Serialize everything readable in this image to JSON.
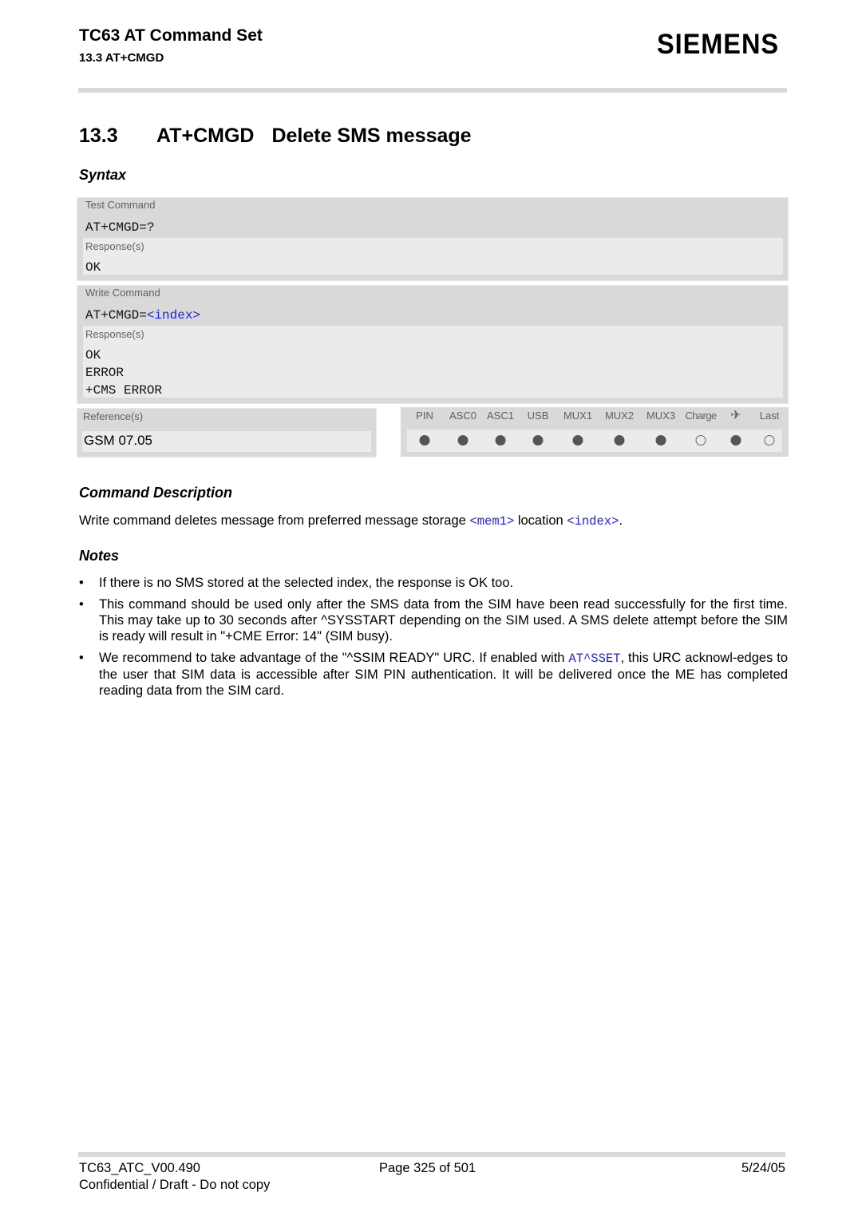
{
  "header": {
    "title": "TC63 AT Command Set",
    "subtitle": "13.3 AT+CMGD",
    "logo": "SIEMENS"
  },
  "section": {
    "number": "13.3",
    "command": "AT+CMGD",
    "title": "Delete SMS message"
  },
  "syntax": {
    "heading": "Syntax",
    "test_command": {
      "label": "Test Command",
      "command": "AT+CMGD=?",
      "responses_label": "Response(s)",
      "responses": [
        "OK"
      ]
    },
    "write_command": {
      "label": "Write Command",
      "command_prefix": "AT+CMGD=",
      "command_param": "<index>",
      "responses_label": "Response(s)",
      "responses": [
        "OK",
        "ERROR",
        "+CMS ERROR"
      ]
    },
    "references": {
      "label": "Reference(s)",
      "value": "GSM 07.05"
    },
    "channels": [
      {
        "label": "PIN",
        "supported": true
      },
      {
        "label": "ASC0",
        "supported": true
      },
      {
        "label": "ASC1",
        "supported": true
      },
      {
        "label": "USB",
        "supported": true
      },
      {
        "label": "MUX1",
        "supported": true
      },
      {
        "label": "MUX2",
        "supported": true
      },
      {
        "label": "MUX3",
        "supported": true
      },
      {
        "label": "Charge",
        "supported": false
      },
      {
        "label": "✈",
        "icon": "airplane-icon",
        "supported": true
      },
      {
        "label": "Last",
        "supported": false
      }
    ]
  },
  "description": {
    "heading": "Command Description",
    "text_before": "Write command deletes message from preferred message storage ",
    "param1": "<mem1>",
    "text_middle": " location ",
    "param2": "<index>",
    "text_after": "."
  },
  "notes": {
    "heading": "Notes",
    "items": [
      {
        "text": "If there is no SMS stored at the selected index, the response is OK too."
      },
      {
        "text": "This command should be used only after the SMS data from the SIM have been read successfully for the first time. This may take up to 30 seconds after ^SYSSTART depending on the SIM used. A SMS delete attempt before the SIM is ready will result in \"+CME Error: 14\" (SIM busy)."
      },
      {
        "text_before": "We recommend to take advantage of the \"^SSIM READY\" URC. If enabled with ",
        "link": "AT^SSET",
        "text_after": ", this URC acknowl-edges to the user that SIM data is accessible after SIM PIN authentication. It will be delivered once the ME has completed reading data from the SIM card."
      }
    ]
  },
  "footer": {
    "doc_id": "TC63_ATC_V00.490",
    "page": "Page 325 of 501",
    "date": "5/24/05",
    "confidential": "Confidential / Draft - Do not copy"
  },
  "colors": {
    "param": "#2222ee",
    "box_bg": "#d9d9d9",
    "box_inner": "#ebebeb",
    "dot": "#555555"
  }
}
